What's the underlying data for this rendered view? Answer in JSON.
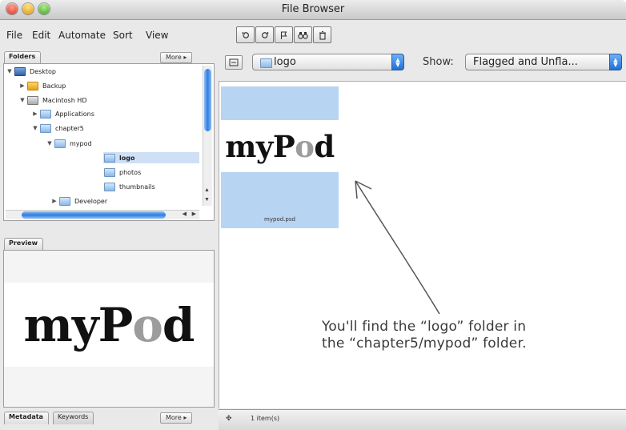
{
  "window": {
    "title": "File Browser"
  },
  "menu": {
    "items": [
      "File",
      "Edit",
      "Automate",
      "Sort",
      "View"
    ]
  },
  "toolbar": {
    "icons": [
      "rotate-left-icon",
      "rotate-right-icon",
      "flag-icon",
      "binoculars-icon",
      "trash-icon"
    ]
  },
  "folders_panel": {
    "tab_label": "Folders",
    "more_label": "More ▸",
    "tree": [
      {
        "label": "Desktop",
        "expanded": true
      },
      {
        "label": "Backup",
        "expanded": false
      },
      {
        "label": "Macintosh HD",
        "expanded": true
      },
      {
        "label": "Applications",
        "expanded": false
      },
      {
        "label": "chapter5",
        "expanded": true
      },
      {
        "label": "mypod",
        "expanded": true
      },
      {
        "label": "logo",
        "selected": true
      },
      {
        "label": "photos"
      },
      {
        "label": "thumbnails"
      },
      {
        "label": "Developer",
        "expanded": false
      }
    ]
  },
  "preview_panel": {
    "tab_label": "Preview",
    "image_text_before": "myP",
    "image_text_o": "o",
    "image_text_after": "d"
  },
  "metadata_panel": {
    "tab_metadata": "Metadata",
    "tab_keywords": "Keywords",
    "more_label": "More ▸"
  },
  "location": {
    "folder": "logo",
    "show_label": "Show:",
    "show_value": "Flagged and Unfla..."
  },
  "thumbnail": {
    "image_text_before": "myP",
    "image_text_o": "o",
    "image_text_after": "d",
    "filename": "mypod.psd"
  },
  "status": {
    "count": "1 item(s)"
  },
  "annotation": {
    "line1": "You'll find the “logo” folder in",
    "line2": "the “chapter5/mypod” folder."
  },
  "colors": {
    "selection": "#b8d4f3",
    "accent": "#2f7ce0"
  }
}
